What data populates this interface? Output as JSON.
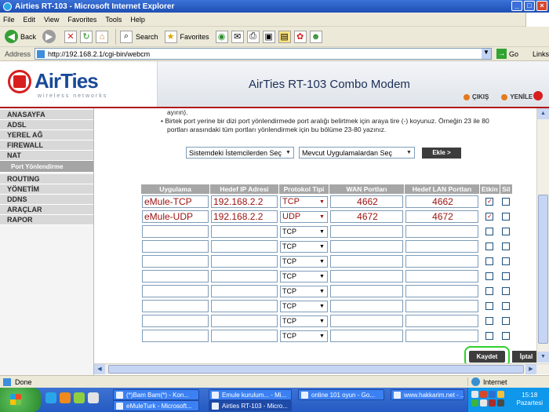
{
  "window": {
    "title": "Airties RT-103 - Microsoft Internet Explorer"
  },
  "menu": [
    "File",
    "Edit",
    "View",
    "Favorites",
    "Tools",
    "Help"
  ],
  "toolbar": {
    "back": "Back",
    "search": "Search",
    "favorites": "Favorites"
  },
  "address": {
    "label": "Address",
    "url": "http://192.168.2.1/cgi-bin/webcm",
    "go": "Go",
    "links": "Links"
  },
  "header": {
    "brand": "AirTies",
    "tagline": "wireless networks",
    "product": "AirTies RT-103 Combo Modem",
    "logout": "ÇIKIŞ",
    "refresh": "YENİLE"
  },
  "sidebar": {
    "items": [
      {
        "label": "ANASAYFA"
      },
      {
        "label": "ADSL"
      },
      {
        "label": "YEREL AĞ"
      },
      {
        "label": "FIREWALL"
      },
      {
        "label": "NAT"
      },
      {
        "label": "Port Yönlendirme"
      },
      {
        "label": "ROUTING"
      },
      {
        "label": "YÖNETİM"
      },
      {
        "label": "DDNS"
      },
      {
        "label": "ARAÇLAR"
      },
      {
        "label": "RAPOR"
      }
    ]
  },
  "content": {
    "desc_line0": "ayırın).",
    "desc_line1": "• Birtek port yerine bir dizi port yönlendirmede port aralığı belirtmek için araya tire (-) koyunuz. Örneğin 23 ile 80",
    "desc_line2": "portları arasındaki tüm portları yönlendirmek için bu bölüme 23-80 yazınız.",
    "select_clients": "Sistemdeki İstemcilerden Seç",
    "select_apps": "Mevcut Uygulamalardan Seç",
    "add_button": "Ekle >",
    "columns": [
      "Uygulama",
      "Hedef IP Adresi",
      "Protokol Tipi",
      "WAN Portları",
      "Hedef LAN Portları",
      "Etkin",
      "Sil"
    ],
    "rows": [
      {
        "app": "eMule-TCP",
        "ip": "192.168.2.2",
        "proto": "TCP",
        "wan": "4662",
        "lan": "4662",
        "enabled": "✓"
      },
      {
        "app": "eMule-UDP",
        "ip": "192.168.2.2",
        "proto": "UDP",
        "wan": "4672",
        "lan": "4672",
        "enabled": "✓"
      },
      {
        "app": "",
        "ip": "",
        "proto": "TCP",
        "wan": "",
        "lan": "",
        "enabled": ""
      },
      {
        "app": "",
        "ip": "",
        "proto": "TCP",
        "wan": "",
        "lan": "",
        "enabled": ""
      },
      {
        "app": "",
        "ip": "",
        "proto": "TCP",
        "wan": "",
        "lan": "",
        "enabled": ""
      },
      {
        "app": "",
        "ip": "",
        "proto": "TCP",
        "wan": "",
        "lan": "",
        "enabled": ""
      },
      {
        "app": "",
        "ip": "",
        "proto": "TCP",
        "wan": "",
        "lan": "",
        "enabled": ""
      },
      {
        "app": "",
        "ip": "",
        "proto": "TCP",
        "wan": "",
        "lan": "",
        "enabled": ""
      },
      {
        "app": "",
        "ip": "",
        "proto": "TCP",
        "wan": "",
        "lan": "",
        "enabled": ""
      },
      {
        "app": "",
        "ip": "",
        "proto": "TCP",
        "wan": "",
        "lan": "",
        "enabled": ""
      }
    ],
    "save_button": "Kaydet",
    "cancel_button": "İptal"
  },
  "status": {
    "text": "Done",
    "zone": "Internet"
  },
  "taskbar": {
    "tasks": [
      {
        "label": "(*)Bam Bam(*) - Kon..."
      },
      {
        "label": "Emule kurulum... - Mi..."
      },
      {
        "label": "online 101 oyun - Go..."
      },
      {
        "label": "www.hakkarim.net - ..."
      },
      {
        "label": "eMuleTurk - Microsoft..."
      },
      {
        "label": "Airties RT-103 - Micro..."
      }
    ],
    "time": "15:18",
    "day": "Pazartesi"
  },
  "colors": {
    "brand_blue": "#1a4a98",
    "brand_red": "#d81e1e",
    "entry_text": "#9b1010",
    "highlight_green": "#2fd12f"
  }
}
